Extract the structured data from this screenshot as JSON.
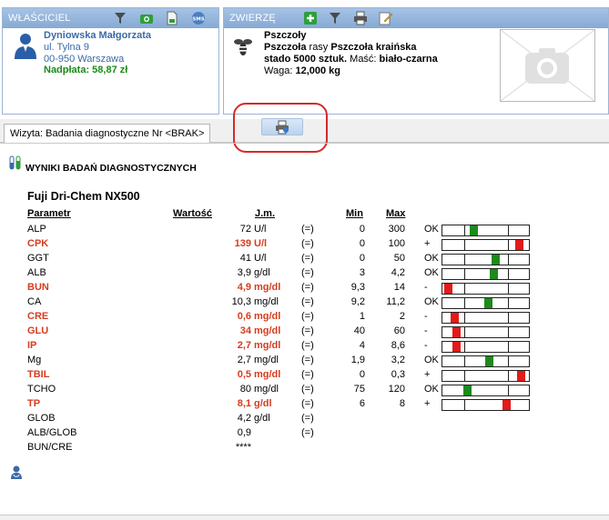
{
  "owner_panel": {
    "title": "WŁAŚCICIEL",
    "name": "Dyniowska Małgorzata",
    "street": "ul. Tylna 9",
    "city": "00-950  Warszawa",
    "payment": "Nadpłata: 58,87 zł",
    "icons": [
      "filter-icon",
      "camera-icon",
      "document-icon",
      "sms-icon"
    ]
  },
  "animals_panel": {
    "title": "ZWIERZĘ",
    "species_group": "Pszczoły",
    "line1_a": "Pszczoła",
    "line1_b": " rasy ",
    "line1_c": "Pszczoła kraińska",
    "line2_a": "stado 5000 sztuk.",
    "line2_b": "  Maść: ",
    "line2_c": "biało-czarna",
    "weight_label": "Waga: ",
    "weight_value": "12,000 kg",
    "icons": [
      "add-icon",
      "filter-icon",
      "print-icon",
      "edit-icon"
    ]
  },
  "tab": {
    "label": "Wizyta: Badania diagnostyczne Nr <BRAK>"
  },
  "results": {
    "section_title": "WYNIKI BADAŃ DIAGNOSTYCZNYCH",
    "device": "Fuji Dri-Chem NX500",
    "headers": {
      "param": "Parametr",
      "value": "Wartość",
      "unit": "J.m.",
      "min": "Min",
      "max": "Max"
    },
    "rows": [
      {
        "name": "ALP",
        "value": "72",
        "unit": "U/l",
        "ref": "(=)",
        "min": "0",
        "max": "300",
        "flag": "OK",
        "abnormal": false,
        "marker": 0.35,
        "color": "#1c8a1c"
      },
      {
        "name": "CPK",
        "value": "139",
        "unit": "U/l",
        "ref": "(=)",
        "min": "0",
        "max": "100",
        "flag": "+",
        "abnormal": true,
        "marker": 0.93,
        "color": "#e21b1b"
      },
      {
        "name": "GGT",
        "value": "41",
        "unit": "U/l",
        "ref": "(=)",
        "min": "0",
        "max": "50",
        "flag": "OK",
        "abnormal": false,
        "marker": 0.63,
        "color": "#1c8a1c"
      },
      {
        "name": "ALB",
        "value": "3,9",
        "unit": "g/dl",
        "ref": "(=)",
        "min": "3",
        "max": "4,2",
        "flag": "OK",
        "abnormal": false,
        "marker": 0.6,
        "color": "#1c8a1c"
      },
      {
        "name": "BUN",
        "value": "4,9",
        "unit": "mg/dl",
        "ref": "(=)",
        "min": "9,3",
        "max": "14",
        "flag": "-",
        "abnormal": true,
        "marker": 0.02,
        "color": "#e21b1b"
      },
      {
        "name": "CA",
        "value": "10,3",
        "unit": "mg/dl",
        "ref": "(=)",
        "min": "9,2",
        "max": "11,2",
        "flag": "OK",
        "abnormal": false,
        "marker": 0.53,
        "color": "#1c8a1c"
      },
      {
        "name": "CRE",
        "value": "0,6",
        "unit": "mg/dl",
        "ref": "(=)",
        "min": "1",
        "max": "2",
        "flag": "-",
        "abnormal": true,
        "marker": 0.1,
        "color": "#e21b1b"
      },
      {
        "name": "GLU",
        "value": "34",
        "unit": "mg/dl",
        "ref": "(=)",
        "min": "40",
        "max": "60",
        "flag": "-",
        "abnormal": true,
        "marker": 0.13,
        "color": "#e21b1b"
      },
      {
        "name": "IP",
        "value": "2,7",
        "unit": "mg/dl",
        "ref": "(=)",
        "min": "4",
        "max": "8,6",
        "flag": "-",
        "abnormal": true,
        "marker": 0.13,
        "color": "#e21b1b"
      },
      {
        "name": "Mg",
        "value": "2,7",
        "unit": "mg/dl",
        "ref": "(=)",
        "min": "1,9",
        "max": "3,2",
        "flag": "OK",
        "abnormal": false,
        "marker": 0.55,
        "color": "#1c8a1c"
      },
      {
        "name": "TBIL",
        "value": "0,5",
        "unit": "mg/dl",
        "ref": "(=)",
        "min": "0",
        "max": "0,3",
        "flag": "+",
        "abnormal": true,
        "marker": 0.95,
        "color": "#e21b1b"
      },
      {
        "name": "TCHO",
        "value": "80",
        "unit": "mg/dl",
        "ref": "(=)",
        "min": "75",
        "max": "120",
        "flag": "OK",
        "abnormal": false,
        "marker": 0.27,
        "color": "#1c8a1c"
      },
      {
        "name": "TP",
        "value": "8,1",
        "unit": "g/dl",
        "ref": "(=)",
        "min": "6",
        "max": "8",
        "flag": "+",
        "abnormal": true,
        "marker": 0.77,
        "color": "#e21b1b"
      },
      {
        "name": "GLOB",
        "value": "4,2",
        "unit": "g/dl",
        "ref": "(=)",
        "min": "",
        "max": "",
        "flag": "",
        "abnormal": false,
        "marker": null,
        "color": ""
      },
      {
        "name": "ALB/GLOB",
        "value": "0,9",
        "unit": "",
        "ref": "(=)",
        "min": "",
        "max": "",
        "flag": "",
        "abnormal": false,
        "marker": null,
        "color": ""
      },
      {
        "name": "BUN/CRE",
        "value": "****",
        "unit": "",
        "ref": "",
        "min": "",
        "max": "",
        "flag": "",
        "abnormal": false,
        "marker": null,
        "color": ""
      }
    ]
  }
}
